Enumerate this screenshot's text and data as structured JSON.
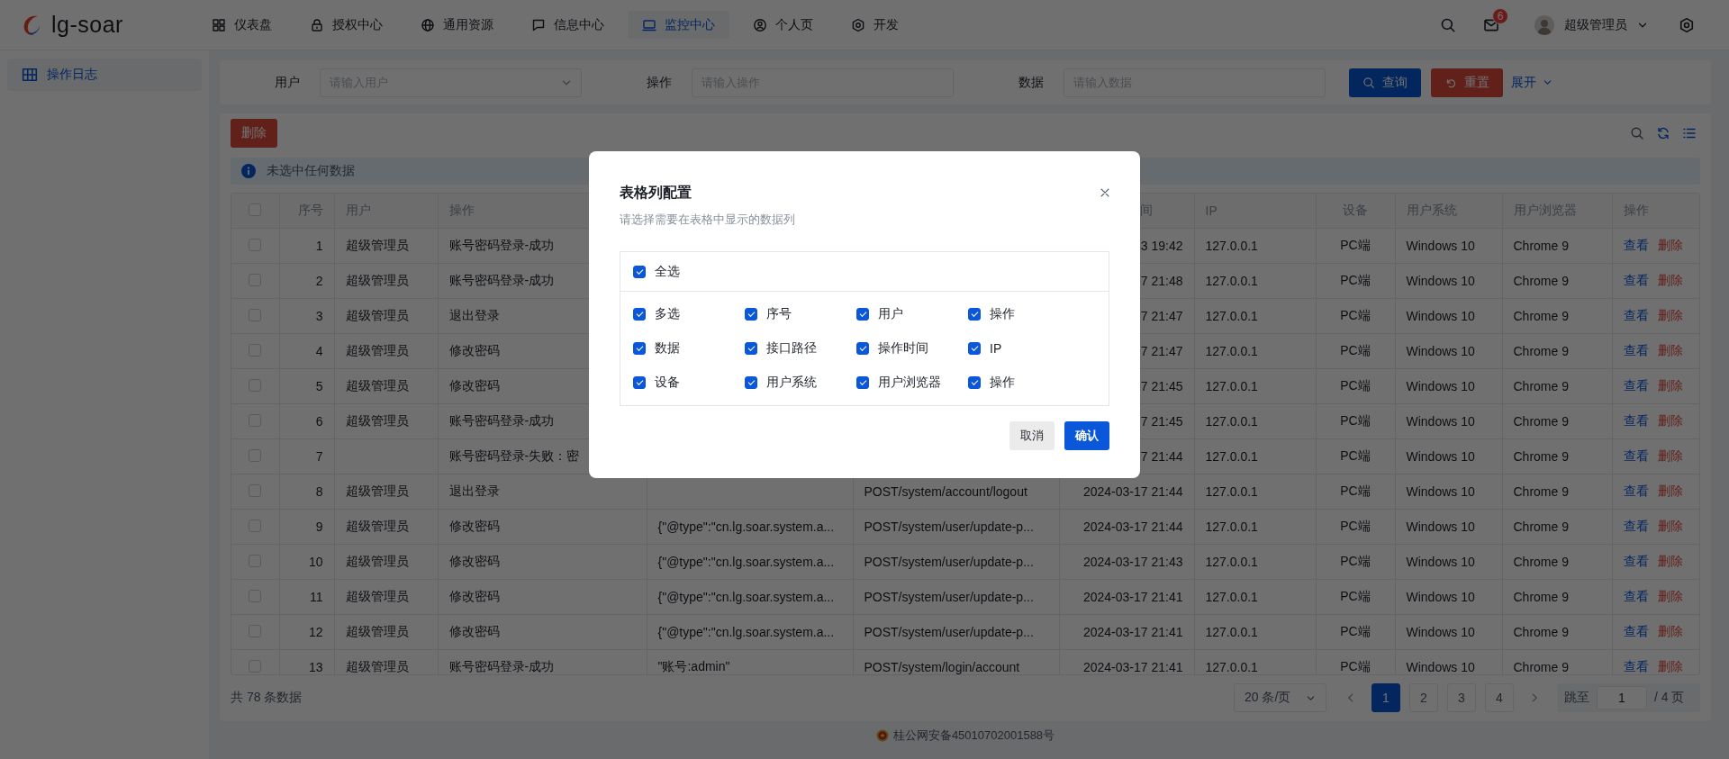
{
  "header": {
    "logo": "lg-soar",
    "nav": [
      {
        "label": "仪表盘",
        "selected": false
      },
      {
        "label": "授权中心",
        "selected": false
      },
      {
        "label": "通用资源",
        "selected": false
      },
      {
        "label": "信息中心",
        "selected": false
      },
      {
        "label": "监控中心",
        "selected": true
      },
      {
        "label": "个人页",
        "selected": false
      },
      {
        "label": "开发",
        "selected": false
      }
    ],
    "notification_count": "6",
    "user_name": "超级管理员"
  },
  "sidebar": {
    "items": [
      {
        "label": "操作日志",
        "selected": true
      }
    ]
  },
  "filters": {
    "fields": [
      {
        "label": "用户",
        "placeholder": "请输入用户",
        "kind": "select"
      },
      {
        "label": "操作",
        "placeholder": "请输入操作",
        "kind": "input"
      },
      {
        "label": "数据",
        "placeholder": "请输入数据",
        "kind": "input"
      }
    ],
    "buttons": [
      {
        "label": "查询",
        "kind": "primary"
      },
      {
        "label": "重置",
        "kind": "danger"
      }
    ],
    "expand": "展开"
  },
  "toolbar": {
    "delete_button": "删除"
  },
  "alert": "未选中任何数据",
  "table": {
    "all_checked": false,
    "columns": {
      "index": "序号",
      "user": "用户",
      "operation": "操作",
      "time": "间",
      "ip": "IP",
      "device": "设备",
      "os": "用户系统",
      "browser": "用户浏览器",
      "actions": "操作"
    },
    "rows": [
      {
        "checked": false,
        "index": "1",
        "user": "超级管理员",
        "operation": "账号密码登录-成功",
        "time": "3 19:42",
        "ip": "127.0.0.1",
        "device": "PC端",
        "os": "Windows 10",
        "browser": "Chrome 9",
        "actions": [
          "查看",
          "删除"
        ]
      },
      {
        "checked": false,
        "index": "2",
        "user": "超级管理员",
        "operation": "账号密码登录-成功",
        "time": "7 21:48",
        "ip": "127.0.0.1",
        "device": "PC端",
        "os": "Windows 10",
        "browser": "Chrome 9",
        "actions": [
          "查看",
          "删除"
        ]
      },
      {
        "checked": false,
        "index": "3",
        "user": "超级管理员",
        "operation": "退出登录",
        "time": "7 21:47",
        "ip": "127.0.0.1",
        "device": "PC端",
        "os": "Windows 10",
        "browser": "Chrome 9",
        "actions": [
          "查看",
          "删除"
        ]
      },
      {
        "checked": false,
        "index": "4",
        "user": "超级管理员",
        "operation": "修改密码",
        "time": "7 21:47",
        "ip": "127.0.0.1",
        "device": "PC端",
        "os": "Windows 10",
        "browser": "Chrome 9",
        "actions": [
          "查看",
          "删除"
        ]
      },
      {
        "checked": false,
        "index": "5",
        "user": "超级管理员",
        "operation": "修改密码",
        "time": "7 21:45",
        "ip": "127.0.0.1",
        "device": "PC端",
        "os": "Windows 10",
        "browser": "Chrome 9",
        "actions": [
          "查看",
          "删除"
        ]
      },
      {
        "checked": false,
        "index": "6",
        "user": "超级管理员",
        "operation": "账号密码登录-成功",
        "time": "7 21:45",
        "ip": "127.0.0.1",
        "device": "PC端",
        "os": "Windows 10",
        "browser": "Chrome 9",
        "actions": [
          "查看",
          "删除"
        ]
      },
      {
        "checked": false,
        "index": "7",
        "operation": "账号密码登录-失败：密",
        "time": "7 21:44",
        "ip": "127.0.0.1",
        "device": "PC端",
        "os": "Windows 10",
        "browser": "Chrome 9",
        "actions": [
          "查看",
          "删除"
        ]
      },
      {
        "checked": false,
        "index": "8",
        "user": "超级管理员",
        "operation": "退出登录",
        "path": "POST/system/account/logout",
        "time": "2024-03-17 21:44",
        "ip": "127.0.0.1",
        "device": "PC端",
        "os": "Windows 10",
        "browser": "Chrome 9",
        "actions": [
          "查看",
          "删除"
        ]
      },
      {
        "checked": false,
        "index": "9",
        "user": "超级管理员",
        "operation": "修改密码",
        "data": "{\"@type\":\"cn.lg.soar.system.a...",
        "path": "POST/system/user/update-p...",
        "time": "2024-03-17 21:44",
        "ip": "127.0.0.1",
        "device": "PC端",
        "os": "Windows 10",
        "browser": "Chrome 9",
        "actions": [
          "查看",
          "删除"
        ]
      },
      {
        "checked": false,
        "index": "10",
        "user": "超级管理员",
        "operation": "修改密码",
        "data": "{\"@type\":\"cn.lg.soar.system.a...",
        "path": "POST/system/user/update-p...",
        "time": "2024-03-17 21:43",
        "ip": "127.0.0.1",
        "device": "PC端",
        "os": "Windows 10",
        "browser": "Chrome 9",
        "actions": [
          "查看",
          "删除"
        ]
      },
      {
        "checked": false,
        "index": "11",
        "user": "超级管理员",
        "operation": "修改密码",
        "data": "{\"@type\":\"cn.lg.soar.system.a...",
        "path": "POST/system/user/update-p...",
        "time": "2024-03-17 21:41",
        "ip": "127.0.0.1",
        "device": "PC端",
        "os": "Windows 10",
        "browser": "Chrome 9",
        "actions": [
          "查看",
          "删除"
        ]
      },
      {
        "checked": false,
        "index": "12",
        "user": "超级管理员",
        "operation": "修改密码",
        "data": "{\"@type\":\"cn.lg.soar.system.a...",
        "path": "POST/system/user/update-p...",
        "time": "2024-03-17 21:41",
        "ip": "127.0.0.1",
        "device": "PC端",
        "os": "Windows 10",
        "browser": "Chrome 9",
        "actions": [
          "查看",
          "删除"
        ]
      },
      {
        "checked": false,
        "index": "13",
        "user": "超级管理员",
        "operation": "账号密码登录-成功",
        "data": "\"账号:admin\"",
        "path": "POST/system/login/account",
        "time": "2024-03-17 21:41",
        "ip": "127.0.0.1",
        "device": "PC端",
        "os": "Windows 10",
        "browser": "Chrome 9",
        "actions": [
          "查看",
          "删除"
        ]
      }
    ]
  },
  "pagination": {
    "total": "共 78 条数据",
    "page_size": "20 条/页",
    "pages": [
      {
        "label": "1",
        "selected": true
      },
      {
        "label": "2",
        "selected": false
      },
      {
        "label": "3",
        "selected": false
      },
      {
        "label": "4",
        "selected": false
      }
    ],
    "jump_label": "跳至",
    "jump_value": "1",
    "page_count": "/ 4 页"
  },
  "footer": "桂公网安备45010702001588号",
  "modal": {
    "title": "表格列配置",
    "description": "请选择需要在表格中显示的数据列",
    "select_all": {
      "label": "全选",
      "checked": true
    },
    "options": [
      {
        "label": "多选",
        "checked": true
      },
      {
        "label": "序号",
        "checked": true
      },
      {
        "label": "用户",
        "checked": true
      },
      {
        "label": "操作",
        "checked": true
      },
      {
        "label": "数据",
        "checked": true
      },
      {
        "label": "接口路径",
        "checked": true
      },
      {
        "label": "操作时间",
        "checked": true
      },
      {
        "label": "IP",
        "checked": true
      },
      {
        "label": "设备",
        "checked": true
      },
      {
        "label": "用户系统",
        "checked": true
      },
      {
        "label": "用户浏览器",
        "checked": true
      },
      {
        "label": "操作",
        "checked": true
      }
    ],
    "buttons": [
      {
        "label": "取消",
        "kind": "secondary"
      },
      {
        "label": "确认",
        "kind": "primary"
      }
    ]
  }
}
